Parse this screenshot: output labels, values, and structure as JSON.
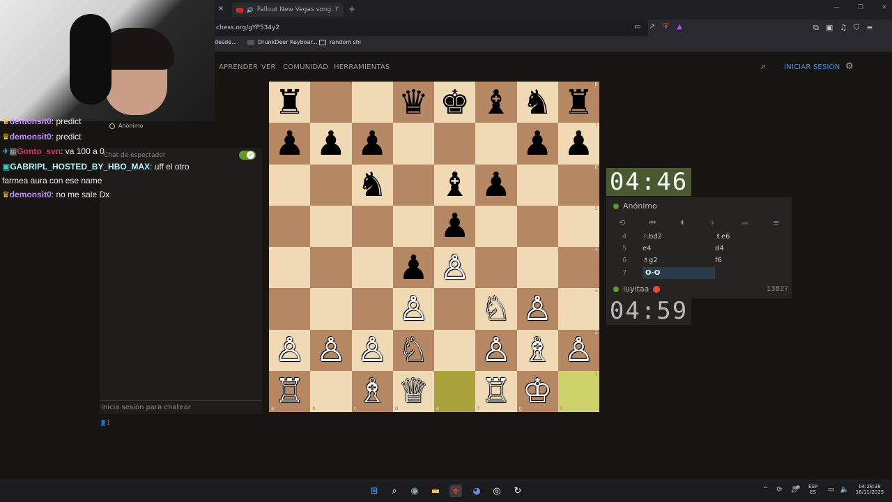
{
  "browser": {
    "tabs": [
      {
        "label": "Fallout New Vegas song: I'm so b",
        "active": false
      }
    ],
    "url": "chess.org/gYP534y2",
    "bookmarks": [
      "desde...",
      "DrunkDeer Keyboar...",
      "random shi"
    ]
  },
  "site_nav": {
    "items": [
      "APRENDER",
      "VER",
      "COMUNIDAD",
      "HERRAMIENTAS"
    ],
    "login": "INICIAR SESIÓN"
  },
  "chat_overlay": [
    {
      "user": "demonsit0",
      "text": ": predict"
    },
    {
      "user": "demonsit0",
      "text": ": predict"
    },
    {
      "user": "Gonto_svn",
      "text": ": va 100 a 0"
    },
    {
      "user": "GABRIPL_HOSTED_BY_HBO_MAX",
      "text": ": uff el otro"
    },
    {
      "user": "",
      "text": "farmea aura con ese name"
    },
    {
      "user": "demonsit0",
      "text": ": no me sale Dx"
    }
  ],
  "chat_panel": {
    "anon_label": "Anónimo",
    "spectator_label": "Chat de espectador",
    "input_placeholder": "Inicia sesión para chatear",
    "viewer_count": "1"
  },
  "board": {
    "ranks": [
      [
        "♜",
        "",
        "",
        "♛",
        "♚",
        "♝",
        "♞",
        "♜"
      ],
      [
        "♟",
        "♟",
        "♟",
        "",
        "",
        "",
        "♟",
        "♟"
      ],
      [
        "",
        "",
        "♞",
        "",
        "♝",
        "♟",
        "",
        ""
      ],
      [
        "",
        "",
        "",
        "",
        "♟",
        "",
        "",
        ""
      ],
      [
        "",
        "",
        "",
        "♟",
        "♙",
        "",
        "",
        ""
      ],
      [
        "",
        "",
        "",
        "♙",
        "",
        "♘",
        "♙",
        ""
      ],
      [
        "♙",
        "♙",
        "♙",
        "♘",
        "",
        "♙",
        "♗",
        "♙"
      ],
      [
        "♖",
        "",
        "♗",
        "♕",
        "",
        "♖",
        "♔",
        ""
      ]
    ],
    "files": [
      "a",
      "b",
      "c",
      "d",
      "e",
      "f",
      "g",
      "h"
    ],
    "rank_labels": [
      "8",
      "7",
      "6",
      "5",
      "4",
      "3",
      "2",
      "1"
    ]
  },
  "game": {
    "top_clock": "04:46",
    "bottom_clock": "04:59",
    "top_player": "Anónimo",
    "bottom_player": "luyitaa",
    "bottom_rating": "1382?",
    "moves": [
      {
        "num": "4",
        "white": "♘bd2",
        "black": "♗e6"
      },
      {
        "num": "5",
        "white": "e4",
        "black": "d4"
      },
      {
        "num": "6",
        "white": "♗g2",
        "black": "f6"
      },
      {
        "num": "7",
        "white": "O-O",
        "black": ""
      }
    ]
  },
  "taskbar": {
    "lang_top": "ESP",
    "lang_bottom": "ES",
    "time": "04:28:36",
    "date": "16/11/2025"
  }
}
